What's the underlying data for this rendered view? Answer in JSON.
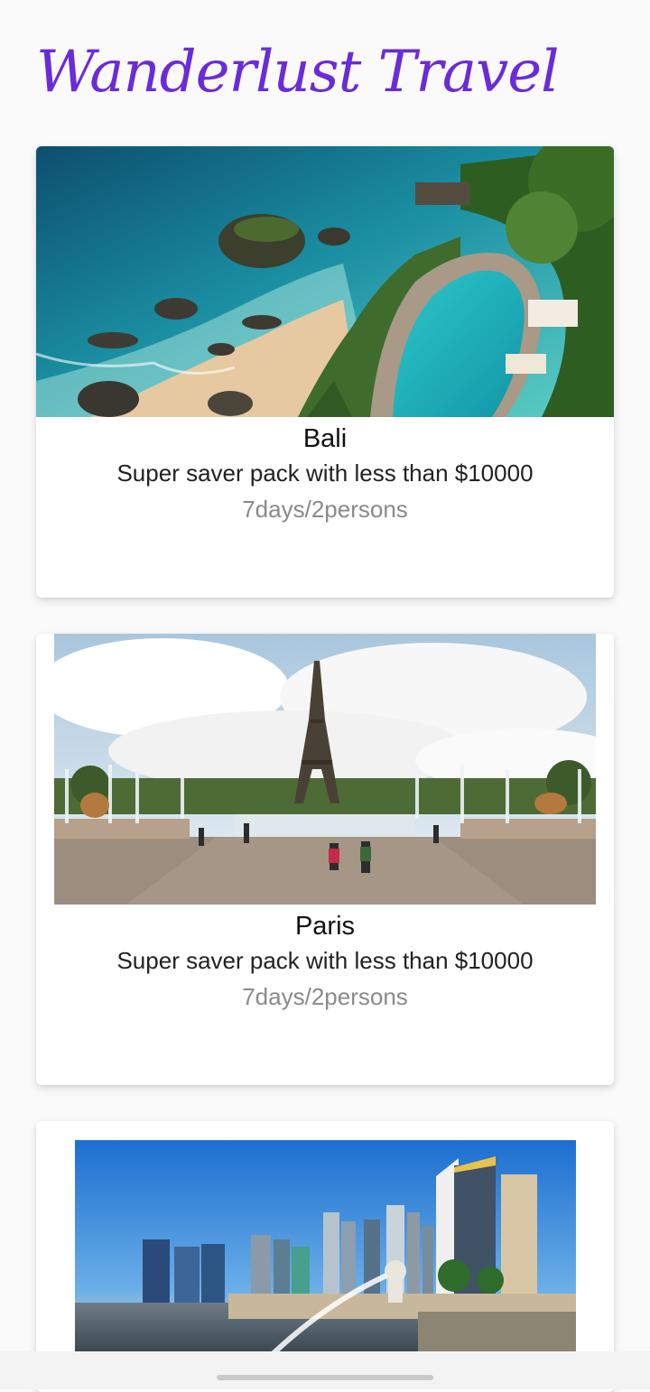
{
  "header": {
    "title": "Wanderlust Travel",
    "title_color": "#6a2bd9"
  },
  "destinations": [
    {
      "name": "Bali",
      "description": "Super saver pack with less than $10000",
      "duration": "7days/2persons",
      "image_icon": "beach-resort-photo"
    },
    {
      "name": "Paris",
      "description": "Super saver pack with less than $10000",
      "duration": "7days/2persons",
      "image_icon": "eiffel-tower-photo"
    },
    {
      "image_icon": "singapore-skyline-photo"
    }
  ]
}
